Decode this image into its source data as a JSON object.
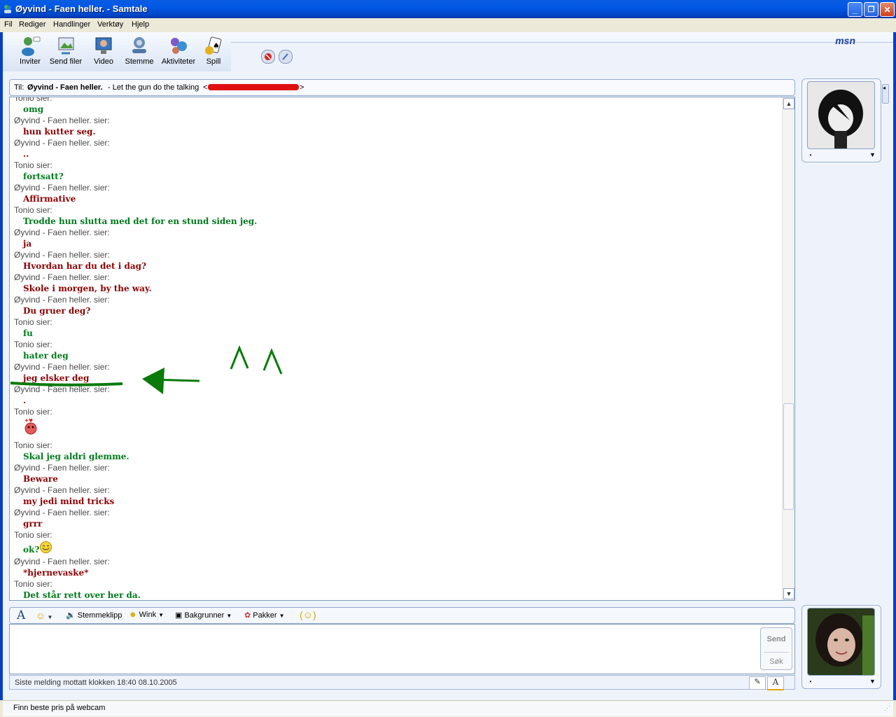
{
  "window": {
    "title": "Øyvind - Faen heller. - Samtale",
    "min": "_",
    "max": "❐",
    "close": "✕"
  },
  "menu": [
    "Fil",
    "Rediger",
    "Handlinger",
    "Verktøy",
    "Hjelp"
  ],
  "toolbar": [
    {
      "label": "Inviter",
      "icon": "invite-icon",
      "color": "#3a8d3a"
    },
    {
      "label": "Send filer",
      "icon": "send-files-icon",
      "color": "#3b7fbf"
    },
    {
      "label": "Video",
      "icon": "video-icon",
      "color": "#3478c6"
    },
    {
      "label": "Stemme",
      "icon": "voice-icon",
      "color": "#4f76a8"
    },
    {
      "label": "Aktiviteter",
      "icon": "activities-icon",
      "color": "#6a5cc8"
    },
    {
      "label": "Spill",
      "icon": "games-icon",
      "color": "#d49a1a"
    }
  ],
  "brand": "msn",
  "to": {
    "prefix": "Til:",
    "name": "Øyvind - Faen heller.",
    "message": " - Let the gun do the talking",
    "email_open": "<",
    "email_close": ">"
  },
  "messages": [
    {
      "who": "Tonio sier:",
      "text": "omg",
      "color": "g"
    },
    {
      "who": "Øyvind - Faen heller. sier:",
      "text": "hun kutter seg.",
      "color": "r"
    },
    {
      "who": "Øyvind - Faen heller. sier:",
      "text": "..",
      "color": "r"
    },
    {
      "who": "Tonio sier:",
      "text": "fortsatt?",
      "color": "g"
    },
    {
      "who": "Øyvind - Faen heller. sier:",
      "text": "Affirmative",
      "color": "r"
    },
    {
      "who": "Tonio sier:",
      "text": "Trodde hun slutta med det for en stund siden jeg.",
      "color": "g"
    },
    {
      "who": "Øyvind - Faen heller. sier:",
      "text": "ja",
      "color": "r"
    },
    {
      "who": "Øyvind - Faen heller. sier:",
      "text": "Hvordan har du det i dag?",
      "color": "r"
    },
    {
      "who": "Øyvind - Faen heller. sier:",
      "text": "Skole i morgen, by the way.",
      "color": "r"
    },
    {
      "who": "Øyvind - Faen heller. sier:",
      "text": "Du gruer deg?",
      "color": "r"
    },
    {
      "who": "Tonio sier:",
      "text": "fu",
      "color": "g"
    },
    {
      "who": "Tonio sier:",
      "text": "hater deg",
      "color": "g"
    },
    {
      "who": "Øyvind - Faen heller. sier:",
      "text": "jeg elsker deg",
      "color": "r"
    },
    {
      "who": "Øyvind - Faen heller. sier:",
      "text": ".",
      "color": "r"
    },
    {
      "who": "Tonio sier:",
      "text": "",
      "color": "g",
      "emoticon": "blush"
    },
    {
      "who": "Tonio sier:",
      "text": "Skal jeg aldri glemme.",
      "color": "g"
    },
    {
      "who": "Øyvind - Faen heller. sier:",
      "text": "Beware",
      "color": "r"
    },
    {
      "who": "Øyvind - Faen heller. sier:",
      "text": "my jedi mind tricks",
      "color": "r"
    },
    {
      "who": "Øyvind - Faen heller. sier:",
      "text": "grrr",
      "color": "r"
    },
    {
      "who": "Tonio sier:",
      "text": "ok?",
      "color": "g",
      "emoticon": "smile"
    },
    {
      "who": "Øyvind - Faen heller. sier:",
      "text": "*hjernevaske*",
      "color": "r"
    },
    {
      "who": "Tonio sier:",
      "text": "Det står rett over her da.",
      "color": "g"
    }
  ],
  "annotation": {
    "color": "#0a7a0a",
    "marks": "^ ^"
  },
  "input_toolbar": {
    "font": "A",
    "voice": "Stemmeklipp",
    "wink": "Wink",
    "backgrounds": "Bakgrunner",
    "packs": "Pakker"
  },
  "send": {
    "send_label": "Send",
    "search_label": "Søk"
  },
  "status": "Siste melding mottatt klokken 18:40 08.10.2005",
  "bottom": "Finn beste pris på webcam"
}
